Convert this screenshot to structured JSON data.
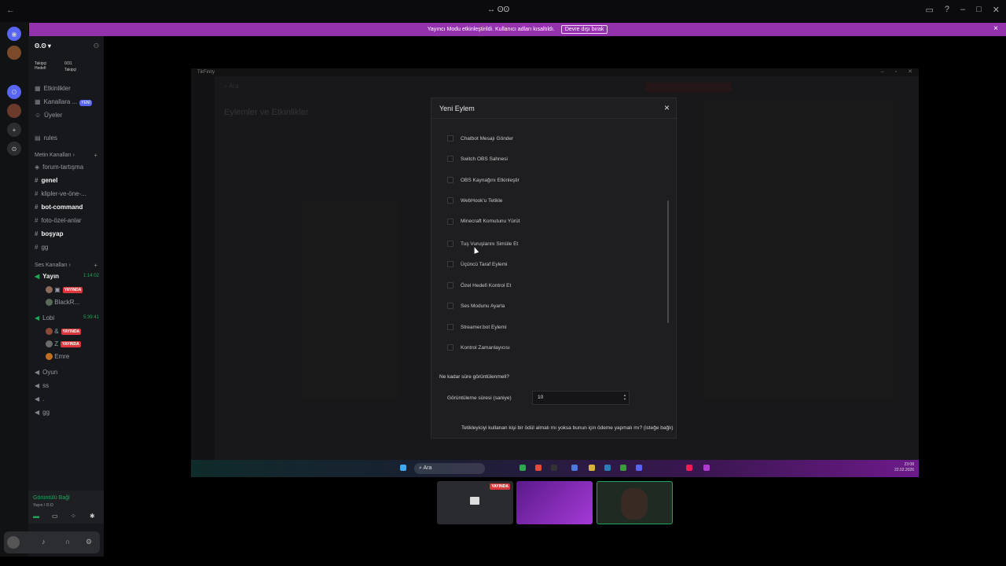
{
  "titlebar": {
    "back": "←",
    "center": "↔ ʘʘ"
  },
  "banner": {
    "text": "Yayıncı Modu etkinleştirildi. Kullanıcı adları kısaltıldı.",
    "button": "Devre dışı bırak",
    "close": "×"
  },
  "server": {
    "name": "ʘ.ʘ",
    "follow_label": "Takipçi Hedefi",
    "follow_count": "0/31",
    "follow_unit": "Takipçi",
    "items": [
      {
        "label": "Etkinlikler"
      },
      {
        "label": "Kanallara ...",
        "badge": "YENİ"
      },
      {
        "label": "Üyeler"
      }
    ],
    "rules": "rules",
    "text_section": "Metin Kanalları",
    "text_channels": [
      "forum-tartışma",
      "genel",
      "klipler-ve-öne-...",
      "bot-command",
      "foto-özel-anlar",
      "boşyap",
      "gg"
    ],
    "voice_section": "Ses Kanalları",
    "voice_channels": [
      {
        "name": "Yayın",
        "time": "1:14:02",
        "members": [
          "",
          "BlackR..."
        ]
      },
      {
        "name": "Lobi",
        "time": "5:39:41",
        "members": [
          "&",
          "Z",
          "Emre"
        ]
      },
      {
        "name": "Oyun"
      },
      {
        "name": "ss"
      },
      {
        "name": "."
      },
      {
        "name": "gg"
      }
    ],
    "live_badge": "YAYINDA"
  },
  "voice_panel": {
    "title": "Görüntülü Bağl",
    "sub": "Yayın / ʘ.ʘ"
  },
  "tikfinity": {
    "title": "TikFinity",
    "heading": "Eylemler ve Etkinlikler",
    "search": "Ara",
    "taskbar_search": "Ara",
    "clock_time": "23:08",
    "clock_date": "22.02.2026"
  },
  "modal": {
    "title": "Yeni Eylem",
    "close": "×",
    "options": [
      "Chatbot Mesajı Gönder",
      "Switch OBS Sahnesi",
      "OBS Kaynağını Etkinleştir",
      "WebHook'u Tetikle",
      "Minecraft Komutunu Yürüt",
      "Tuş Vuruşlarını Simüle Et",
      "Üçüncü Taraf Eylemi",
      "Özel Hedefi Kontrol Et",
      "Ses Modunu Ayarla",
      "Streamer.bot Eylemi",
      "Kontrol Zamanlayıcısı"
    ],
    "duration_question": "Ne kadar süre görüntülenmeli?",
    "duration_label": "Görüntüleme süresi (saniye)",
    "duration_value": "10",
    "payment_question": "Tetikleyiciyi kullanan kişi bir ödül almalı mı yoksa bunun için ödeme yapmalı mı? (isteğe bağlı)"
  },
  "thumbnails": {
    "live_badge": "YAYINDA"
  }
}
